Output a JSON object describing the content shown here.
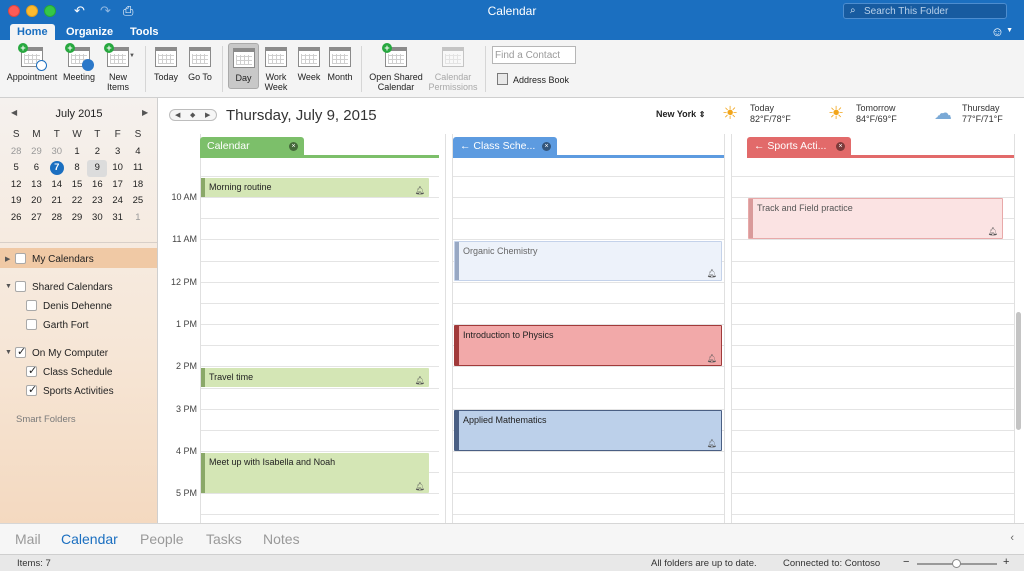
{
  "window": {
    "title": "Calendar"
  },
  "search": {
    "placeholder": "Search This Folder"
  },
  "ribbon_tabs": [
    "Home",
    "Organize",
    "Tools"
  ],
  "ribbon": {
    "appointment": "Appointment",
    "meeting": "Meeting",
    "new_items": [
      "New",
      "Items"
    ],
    "today": "Today",
    "go_to": "Go To",
    "day": "Day",
    "work_week": [
      "Work",
      "Week"
    ],
    "week": "Week",
    "month": "Month",
    "open_shared": [
      "Open Shared",
      "Calendar"
    ],
    "permissions": [
      "Calendar",
      "Permissions"
    ],
    "find_contact_placeholder": "Find a Contact",
    "address_book": "Address Book"
  },
  "mini_calendar": {
    "month": "July 2015",
    "weekdays": [
      "S",
      "M",
      "T",
      "W",
      "T",
      "F",
      "S"
    ],
    "weeks": [
      [
        "28",
        "29",
        "30",
        "1",
        "2",
        "3",
        "4"
      ],
      [
        "5",
        "6",
        "7",
        "8",
        "9",
        "10",
        "11"
      ],
      [
        "12",
        "13",
        "14",
        "15",
        "16",
        "17",
        "18"
      ],
      [
        "19",
        "20",
        "21",
        "22",
        "23",
        "24",
        "25"
      ],
      [
        "26",
        "27",
        "28",
        "29",
        "30",
        "31",
        "1"
      ]
    ],
    "today": "7",
    "selected": "9"
  },
  "sidebar": {
    "my_calendars": "My Calendars",
    "shared_calendars": "Shared Calendars",
    "shared_items": [
      "Denis Dehenne",
      "Garth Fort"
    ],
    "on_my_computer": "On My Computer",
    "computer_items": [
      "Class Schedule",
      "Sports Activities"
    ],
    "smart_folders": "Smart Folders"
  },
  "header": {
    "date": "Thursday, July 9, 2015",
    "city": "New York",
    "weather": [
      {
        "day": "Today",
        "temp": "82°F/78°F",
        "icon": "sun-cloud-icon"
      },
      {
        "day": "Tomorrow",
        "temp": "84°F/69°F",
        "icon": "sun-cloud-icon"
      },
      {
        "day": "Thursday",
        "temp": "77°F/71°F",
        "icon": "rain-cloud-icon"
      }
    ]
  },
  "time_labels": [
    "10 AM",
    "11 AM",
    "12 PM",
    "1 PM",
    "2 PM",
    "3 PM",
    "4 PM",
    "5 PM"
  ],
  "columns": [
    {
      "name": "Calendar",
      "color": "#7cbf6a"
    },
    {
      "name": "Class Sche...",
      "color": "#5d9be0"
    },
    {
      "name": "Sports Acti...",
      "color": "#e26a6a"
    }
  ],
  "events": {
    "morning_routine": "Morning routine",
    "travel_time": "Travel time",
    "meet_up": "Meet up with Isabella and Noah",
    "organic_chem": "Organic Chemistry",
    "intro_physics": "Introduction to Physics",
    "applied_math": "Applied Mathematics",
    "track_field": "Track and Field practice"
  },
  "bottom_nav": [
    "Mail",
    "Calendar",
    "People",
    "Tasks",
    "Notes"
  ],
  "status": {
    "items": "Items: 7",
    "sync": "All folders are up to date.",
    "connection": "Connected to: Contoso"
  }
}
